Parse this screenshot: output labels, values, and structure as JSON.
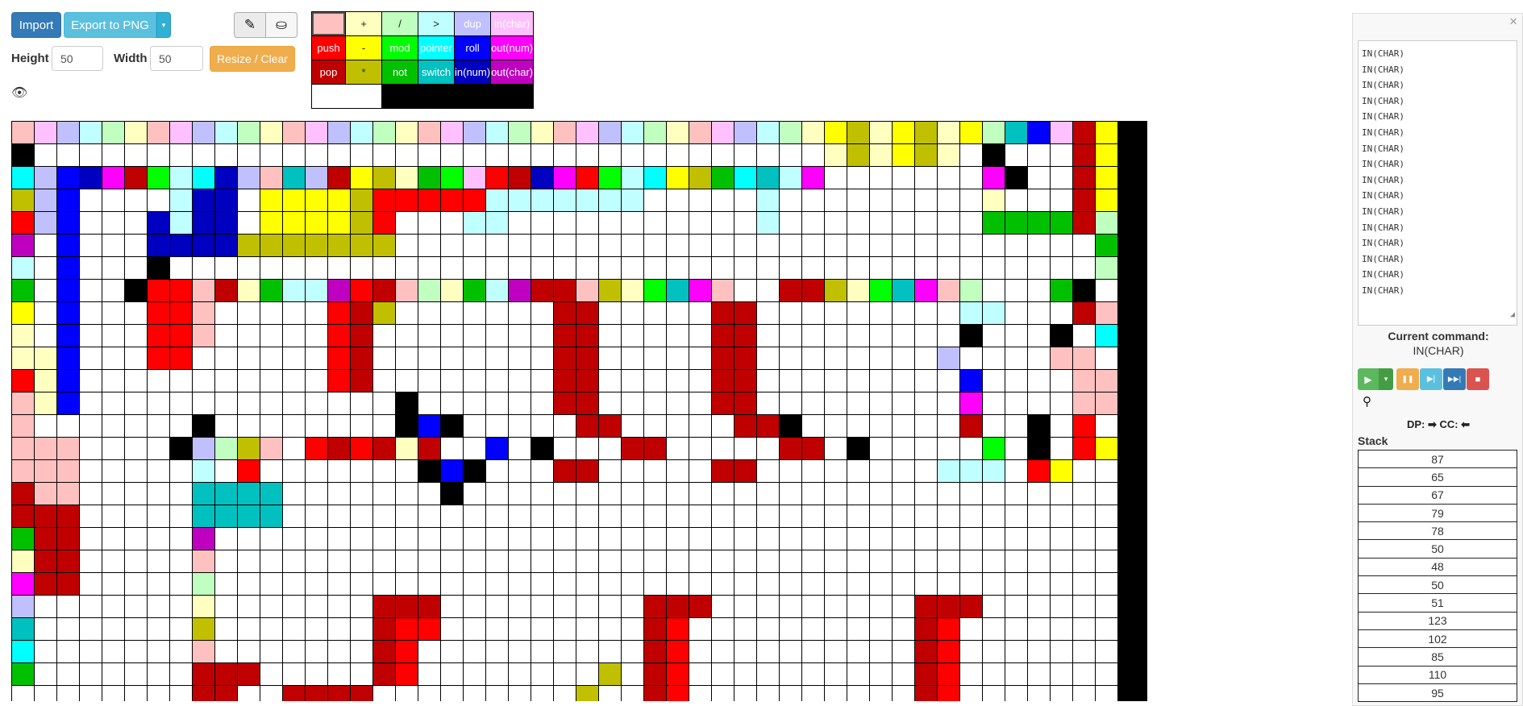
{
  "toolbar": {
    "import_label": "Import",
    "export_label": "Export to PNG",
    "export_caret": "▾",
    "height_label": "Height",
    "height_value": "50",
    "width_label": "Width",
    "width_value": "50",
    "resize_label": "Resize / Clear",
    "pencil_icon": "✎",
    "fill_icon": "⛀",
    "eye_icon": "👁"
  },
  "palette": {
    "rows": [
      [
        {
          "label": "",
          "bg": "#ffc0c0",
          "dark": true,
          "sel": true
        },
        {
          "label": "+",
          "bg": "#ffffc0",
          "dark": true
        },
        {
          "label": "/",
          "bg": "#c0ffc0",
          "dark": true
        },
        {
          "label": ">",
          "bg": "#c0ffff",
          "dark": true
        },
        {
          "label": "dup",
          "bg": "#c0c0ff"
        },
        {
          "label": "in(char)",
          "bg": "#ffc0ff"
        }
      ],
      [
        {
          "label": "push",
          "bg": "#ff0000"
        },
        {
          "label": "-",
          "bg": "#ffff00",
          "dark": true
        },
        {
          "label": "mod",
          "bg": "#00ff00"
        },
        {
          "label": "pointer",
          "bg": "#00ffff"
        },
        {
          "label": "roll",
          "bg": "#0000ff"
        },
        {
          "label": "out(num)",
          "bg": "#ff00ff"
        }
      ],
      [
        {
          "label": "pop",
          "bg": "#c00000"
        },
        {
          "label": "*",
          "bg": "#c0c000",
          "dark": true
        },
        {
          "label": "not",
          "bg": "#00c000"
        },
        {
          "label": "switch",
          "bg": "#00c0c0"
        },
        {
          "label": "in(num)",
          "bg": "#0000c0"
        },
        {
          "label": "out(char)",
          "bg": "#c000c0"
        }
      ]
    ],
    "bottom_white": "#ffffff",
    "bottom_black": "#000000"
  },
  "grid": {
    "legend": {
      ".": "#ffffff",
      "K": "#000000",
      "a": "#ffc0c0",
      "b": "#ffffc0",
      "c": "#c0ffc0",
      "d": "#c0ffff",
      "e": "#c0c0ff",
      "f": "#ffc0ff",
      "A": "#ff0000",
      "B": "#ffff00",
      "C": "#00ff00",
      "D": "#00ffff",
      "E": "#0000ff",
      "F": "#ff00ff",
      "g": "#c00000",
      "h": "#c0c000",
      "i": "#00c000",
      "j": "#00c0c0",
      "k": "#0000c0",
      "l": "#c000c0"
    },
    "rows": [
      "afedcbafedcbafedcbafedcbafedcbafedcbBhbBhbBcjEfgBK",
      "K...................................bhbBhb.K...gBK",
      "DeEkFgCdDkeajegBhbiCfAgkFACdDBhiDjdF.......FK..gBK",
      "heE....dkk.BBBBhAAAAAddddddd.....d.........b...gBK",
      "AeE...kdkk.BBBBhA...dd...........d.........iiiigcK",
      "l.E...kkkkhhhhhhh...............................iccgDK",
      "d.E...K.........................................cK.gfK",
      "i.E..KAAagbiddlAgacbidlggahbCjFa..gghbCjFac...iK.Kgg",
      "B.E...AAa.....Agh.......gg.....gg.........dd...ga",
      "b.E...AAa.....Ag........gg.....gg.........K...K.D...aa",
      "bbE...AA......Ag........gg.....gg........eе...aa",
      "AbE...........Ag........gg.....gg.........E....aa",
      "abE..............K......gg.....gg.........F....aa",
      "a.......K........KEK.....gg.....ggK.......g..K.A",
      "aaa....Kecha AgAgbg..E K...gg.....gg.K.....C.K.AB",
      "aaa.....d.A.......KEK...gg.....gg........ddd.AB",
      "gaa.....jjjj.......K...............................dddgi",
      "ggg.....jjjj.......................................DDDDgd",
      "igg.....l..........................................DDDDgl",
      "bgg.....a..........................................jj..AA",
      "Fgg.....c..........................................d...AA",
      "e.......b.......ggg.........ggg.........ggg.......kF...gA",
      "j.......h.......gAA.........gA..........gA........FF...gg",
      "D.......a.......gA..........gA..........gA........l....gg",
      "i.......ggg.....gA........h.gA..........gA........g....gg",
      "........gg..gggg.........h..gA..........gA........b....gg"
    ]
  },
  "panel": {
    "close_icon": "×",
    "log_lines": [
      "IN(CHAR)",
      "IN(CHAR)",
      "IN(CHAR)",
      "IN(CHAR)",
      "IN(CHAR)",
      "IN(CHAR)",
      "IN(CHAR)",
      "IN(CHAR)",
      "IN(CHAR)",
      "IN(CHAR)",
      "IN(CHAR)",
      "IN(CHAR)",
      "IN(CHAR)",
      "IN(CHAR)",
      "IN(CHAR)",
      "IN(CHAR)"
    ],
    "current_title": "Current command:",
    "current_command": "IN(CHAR)",
    "play_icon": "▶",
    "play_caret": "▾",
    "pause_icon": "❚❚",
    "step_icon": "▶|",
    "fast_forward_icon": "▶▶|",
    "stop_icon": "■",
    "pin_icon": "⚲",
    "dp_cc": "DP: ➡   CC: ⬅",
    "stack_title": "Stack",
    "stack": [
      "87",
      "65",
      "67",
      "79",
      "78",
      "50",
      "48",
      "50",
      "51",
      "123",
      "102",
      "85",
      "110",
      "95"
    ],
    "colors": {
      "green": "#5cb85c",
      "orange": "#f0ad4e",
      "blue": "#5bc0de",
      "navy": "#337ab7",
      "red": "#d9534f"
    }
  }
}
